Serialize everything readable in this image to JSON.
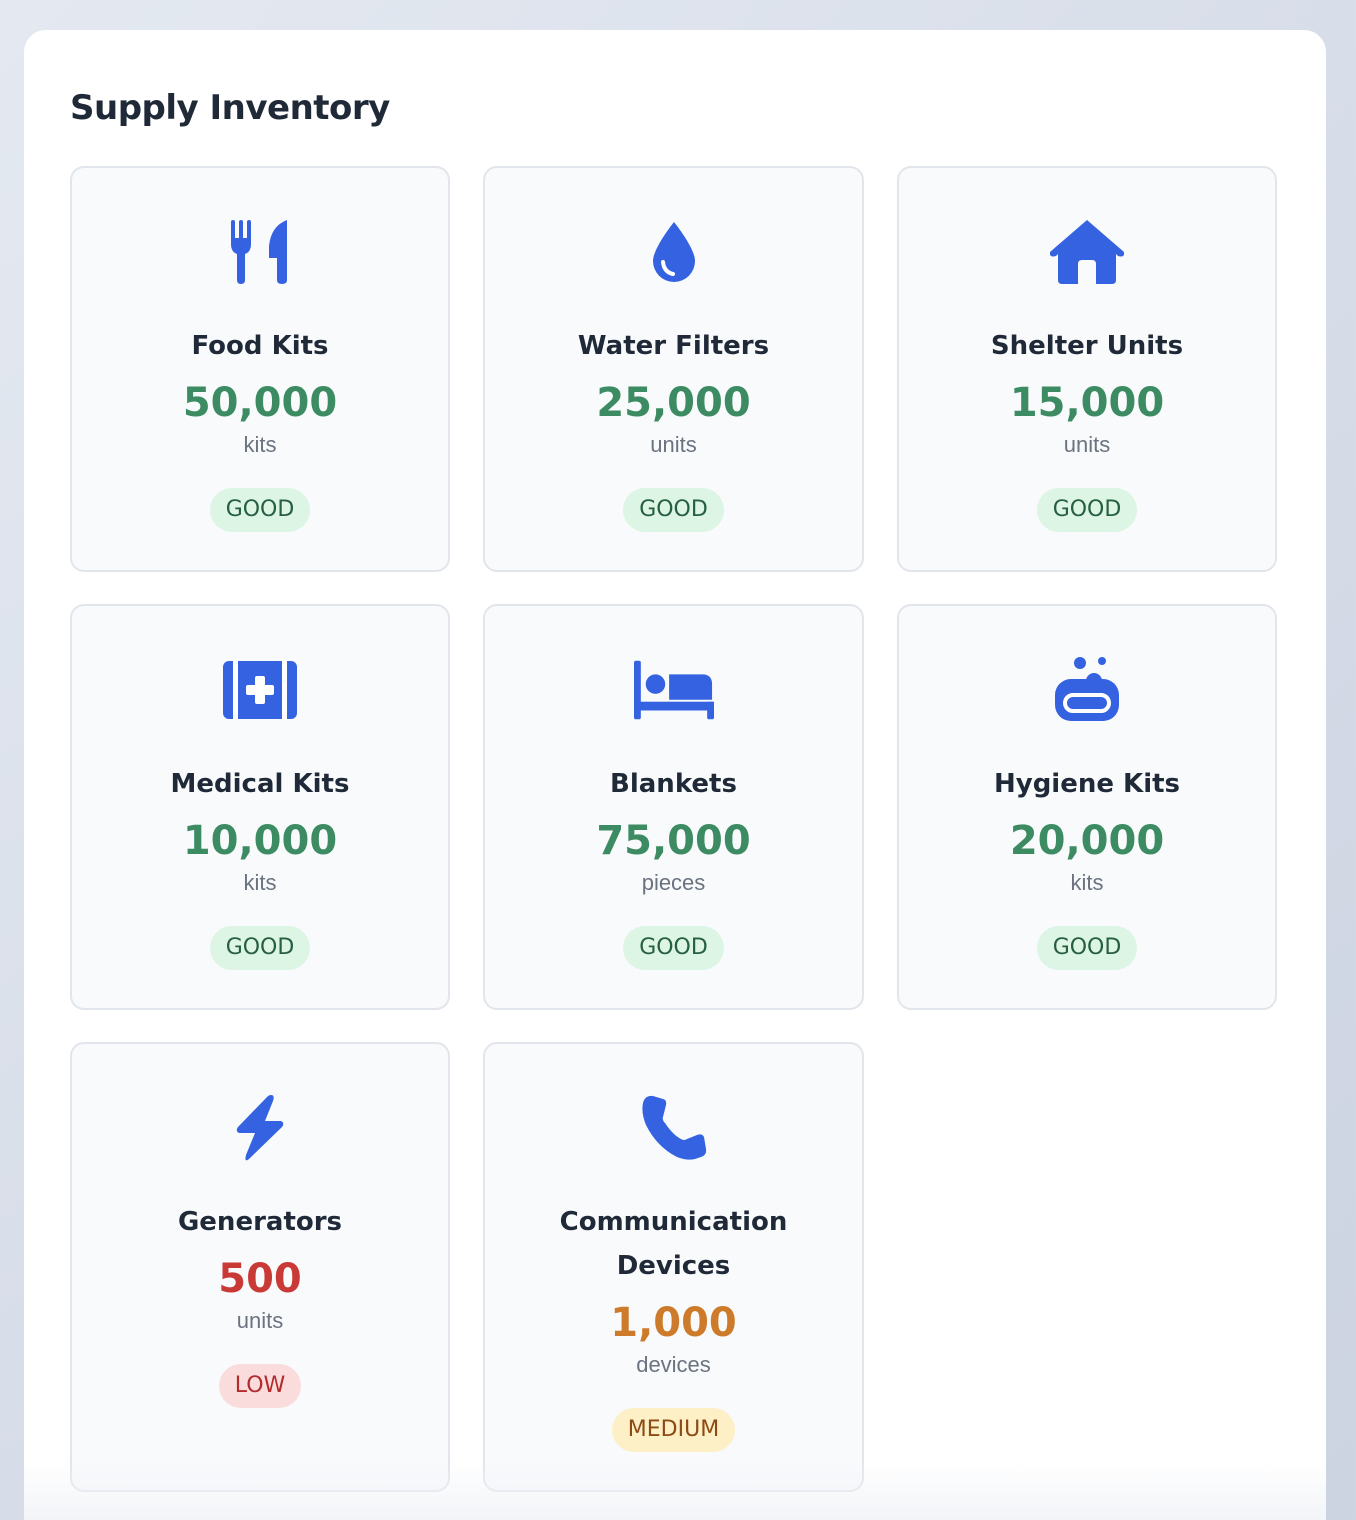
{
  "panel": {
    "title": "Supply Inventory"
  },
  "colors": {
    "icon": "#3562e0",
    "good": "#3d8b62",
    "low": "#c93a36",
    "medium": "#cd7a2a"
  },
  "supplies": [
    {
      "name": "Food Kits",
      "quantity": "50,000",
      "unit": "kits",
      "status": "GOOD",
      "level": "good",
      "icon": "utensils-icon"
    },
    {
      "name": "Water Filters",
      "quantity": "25,000",
      "unit": "units",
      "status": "GOOD",
      "level": "good",
      "icon": "water-drop-icon"
    },
    {
      "name": "Shelter Units",
      "quantity": "15,000",
      "unit": "units",
      "status": "GOOD",
      "level": "good",
      "icon": "house-icon"
    },
    {
      "name": "Medical Kits",
      "quantity": "10,000",
      "unit": "kits",
      "status": "GOOD",
      "level": "good",
      "icon": "medical-kit-icon"
    },
    {
      "name": "Blankets",
      "quantity": "75,000",
      "unit": "pieces",
      "status": "GOOD",
      "level": "good",
      "icon": "bed-icon"
    },
    {
      "name": "Hygiene Kits",
      "quantity": "20,000",
      "unit": "kits",
      "status": "GOOD",
      "level": "good",
      "icon": "soap-icon"
    },
    {
      "name": "Generators",
      "quantity": "500",
      "unit": "units",
      "status": "LOW",
      "level": "low",
      "icon": "lightning-bolt-icon"
    },
    {
      "name": "Communication Devices",
      "quantity": "1,000",
      "unit": "devices",
      "status": "MEDIUM",
      "level": "medium",
      "icon": "phone-icon"
    }
  ]
}
